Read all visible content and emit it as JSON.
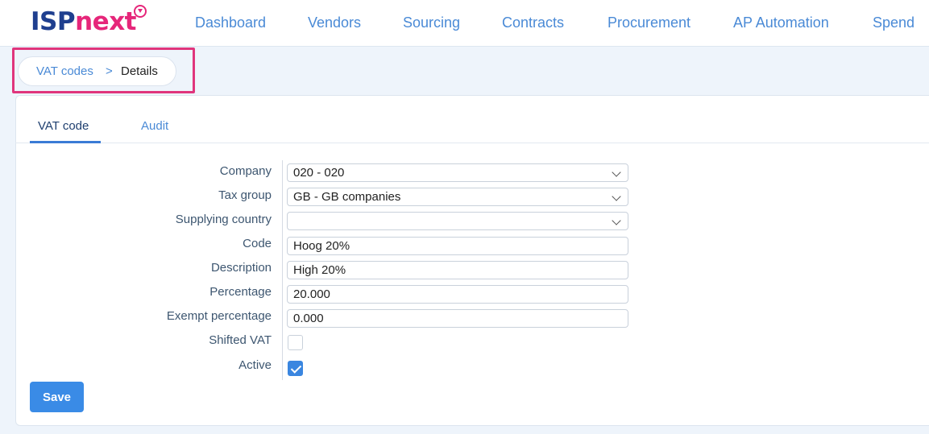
{
  "brand": {
    "logo_part1": "ISP",
    "logo_part2": "next"
  },
  "nav": {
    "items": [
      "Dashboard",
      "Vendors",
      "Sourcing",
      "Contracts",
      "Procurement",
      "AP Automation",
      "Spend"
    ]
  },
  "breadcrumb": {
    "parent": "VAT codes",
    "separator": ">",
    "current": "Details"
  },
  "tabs": [
    "VAT code",
    "Audit"
  ],
  "form": {
    "company": {
      "label": "Company",
      "value": "020 - 020"
    },
    "tax_group": {
      "label": "Tax group",
      "value": "GB - GB companies"
    },
    "supplying_country": {
      "label": "Supplying country",
      "value": ""
    },
    "code": {
      "label": "Code",
      "value": "Hoog 20%"
    },
    "description": {
      "label": "Description",
      "value": "High 20%"
    },
    "percentage": {
      "label": "Percentage",
      "value": "20.000"
    },
    "exempt_percentage": {
      "label": "Exempt percentage",
      "value": "0.000"
    },
    "shifted_vat": {
      "label": "Shifted VAT",
      "checked": false
    },
    "active": {
      "label": "Active",
      "checked": true
    }
  },
  "actions": {
    "save_label": "Save"
  },
  "colors": {
    "accent": "#3a8be6",
    "brand_blue": "#1f3f8f",
    "brand_pink": "#e6267a",
    "highlight": "#e0357c"
  }
}
